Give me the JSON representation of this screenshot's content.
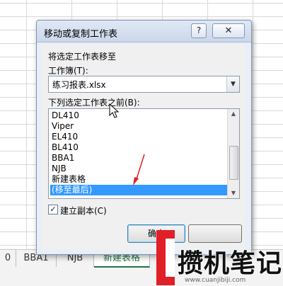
{
  "dialog": {
    "title": "移动或复制工作表",
    "help_label": "?",
    "close_label": "✕",
    "move_to_label": "将选定工作表移至",
    "workbook_label": "工作簿(T):",
    "workbook_value": "练习报表.xlsx",
    "before_sheet_label": "下列选定工作表之前(B):",
    "sheets": [
      "DL410",
      "Viper",
      "EL410",
      "BL410",
      "BBA1",
      "NJB",
      "新建表格",
      "(移至最后)"
    ],
    "selected_index": 7,
    "create_copy_label": "建立副本(C)",
    "create_copy_checked": true,
    "ok_label": "确定",
    "cancel_label": ""
  },
  "sheet_tabs": [
    "0",
    "BBA1",
    "NJB",
    "新建表格"
  ],
  "active_tab_index": 3,
  "watermark": {
    "text": "攒机笔记",
    "url": "www.cuanjibiji.com"
  },
  "colors": {
    "selection": "#3399ff",
    "active_tab": "#217346",
    "annotation_arrow": "#e02020",
    "watermark_red": "#e01f26"
  }
}
